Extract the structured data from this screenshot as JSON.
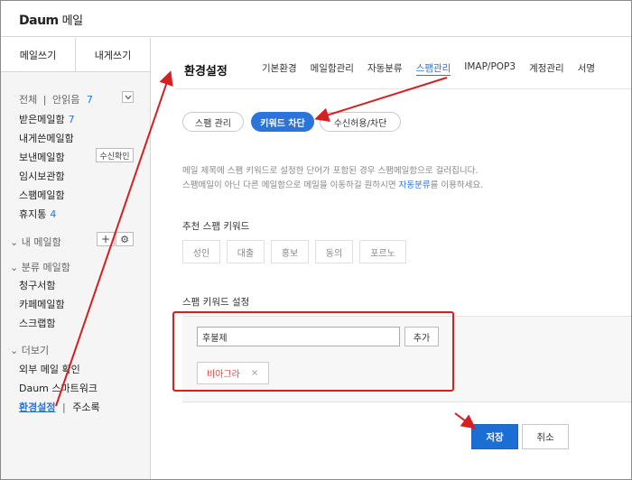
{
  "app": {
    "logo": "Daum",
    "service": "메일"
  },
  "sidebar": {
    "compose": "메일쓰기",
    "self": "내게쓰기",
    "all": "전체",
    "unread": "안읽음",
    "unread_count": "7",
    "folders": [
      {
        "label": "받은메일함",
        "count": "7"
      },
      {
        "label": "내게쓴메일함",
        "count": ""
      },
      {
        "label": "보낸메일함",
        "count": ""
      },
      {
        "label": "임시보관함",
        "count": ""
      },
      {
        "label": "스팸메일함",
        "count": ""
      },
      {
        "label": "휴지통",
        "count": "4"
      }
    ],
    "receipt_button": "수신확인",
    "my_mailbox": "내 메일함",
    "classify": "분류 메일함",
    "classify_items": [
      "청구서함",
      "카페메일함",
      "스크랩함"
    ],
    "more": "더보기",
    "more_items": [
      "외부 메일 확인",
      "Daum 스마트워크"
    ],
    "settings_link": "환경설정",
    "contacts_link": "주소록"
  },
  "main": {
    "title": "환경설정",
    "tabs": [
      "기본환경",
      "메일함관리",
      "자동분류",
      "스팸관리",
      "IMAP/POP3",
      "계정관리",
      "서명"
    ],
    "active_tab": "스팸관리",
    "subtabs": [
      "스팸 관리",
      "키워드 차단",
      "수신허용/차단"
    ],
    "desc_line1": "메일 제목에 스팸 키워드로 설정한 단어가 포함된 경우 스팸메일함으로 걸러집니다.",
    "desc_line2_pre": "스팸메일이 아닌 다른 메일함으로 메일을 이동하길 원하시면 ",
    "desc_line2_link": "자동분류",
    "desc_line2_post": "를 이용하세요.",
    "recommend_title": "추천 스팸 키워드",
    "recommend": [
      "성인",
      "대출",
      "홍보",
      "동의",
      "포르노"
    ],
    "setting_title": "스팸 키워드 설정",
    "input_value": "후불제",
    "add_button": "추가",
    "tag": "비아그라",
    "tag_remove": "×",
    "save": "저장",
    "cancel": "취소"
  },
  "colors": {
    "accent": "#2b74d9",
    "annotation": "#d42020",
    "tag_text": "#e0453a"
  }
}
